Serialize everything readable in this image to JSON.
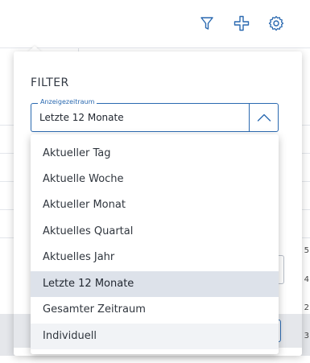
{
  "toolbar": {
    "filter_icon": "filter-icon",
    "add_icon": "plus-icon",
    "settings_icon": "gear-icon",
    "accent": "#2a69b0"
  },
  "background": {
    "row_digits": [
      "5",
      "4",
      "2",
      "3"
    ]
  },
  "filter": {
    "title": "FILTER",
    "field_label": "Anzeigezeitraum",
    "selected_value": "Letzte 12 Monate",
    "toggle_icon": "chevron-up-icon",
    "options": [
      "Aktueller Tag",
      "Aktuelle Woche",
      "Aktueller Monat",
      "Aktuelles Quartal",
      "Aktuelles Jahr",
      "Letzte 12 Monate",
      "Gesamter Zeitraum",
      "Individuell"
    ],
    "selected_index": 5,
    "hovered_index": 7
  }
}
